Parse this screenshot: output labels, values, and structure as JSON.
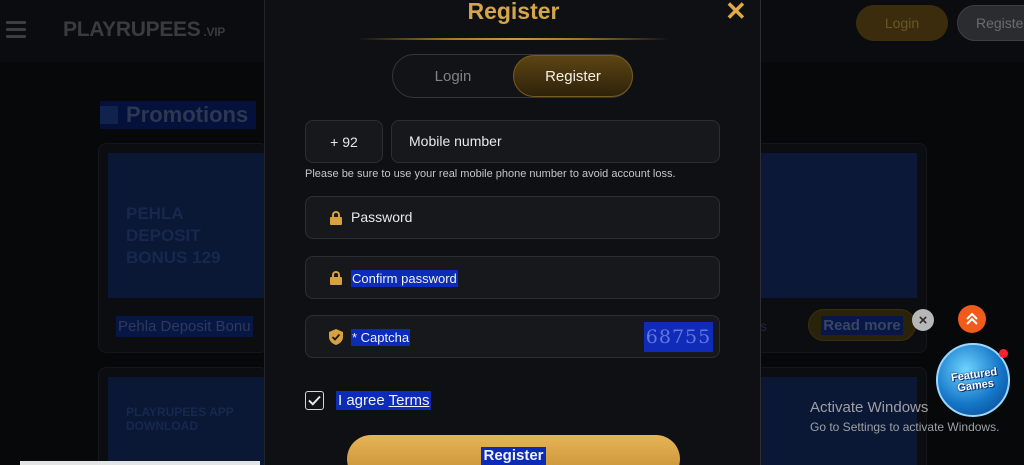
{
  "header": {
    "logo_text": "PLAYRUPEES",
    "logo_suffix": ".VIP",
    "login_label": "Login",
    "register_label": "Registe"
  },
  "promotions": {
    "section_title": "Promotions",
    "card1_banner_text": "PEHLA DEPOSIT BONUS 129",
    "card1_title": "Pehla Deposit Bonu",
    "card2_banner_text": "PLAYRUPEES APP DOWNLOAD",
    "right_banner_text": "",
    "right_partial_text": "s",
    "read_more_label": "Read more"
  },
  "modal": {
    "title": "Register",
    "close_icon": "close-icon",
    "tabs": [
      {
        "label": "Login",
        "active": false
      },
      {
        "label": "Register",
        "active": true
      }
    ],
    "country_code": "+ 92",
    "mobile_placeholder": "Mobile number",
    "mobile_hint": "Please be sure to use your real mobile phone number to avoid account loss.",
    "password_placeholder": "Password",
    "confirm_password_placeholder": "Confirm password",
    "captcha_placeholder": "* Captcha",
    "captcha_code": "68755",
    "agree_prefix": "I agree",
    "agree_link": "Terms",
    "agree_checked": true,
    "submit_label": "Register"
  },
  "floating": {
    "featured_text": "Featured Games",
    "scroll_top_icon": "chevron-double-up-icon",
    "dismiss_icon": "close-icon"
  },
  "system_notice": {
    "line1": "Activate Windows",
    "line2": "Go to Settings to activate Windows."
  },
  "colors": {
    "accent_gold": "#d3a64a",
    "selection_blue": "#0b2bb8",
    "modal_bg": "#0f1013"
  }
}
